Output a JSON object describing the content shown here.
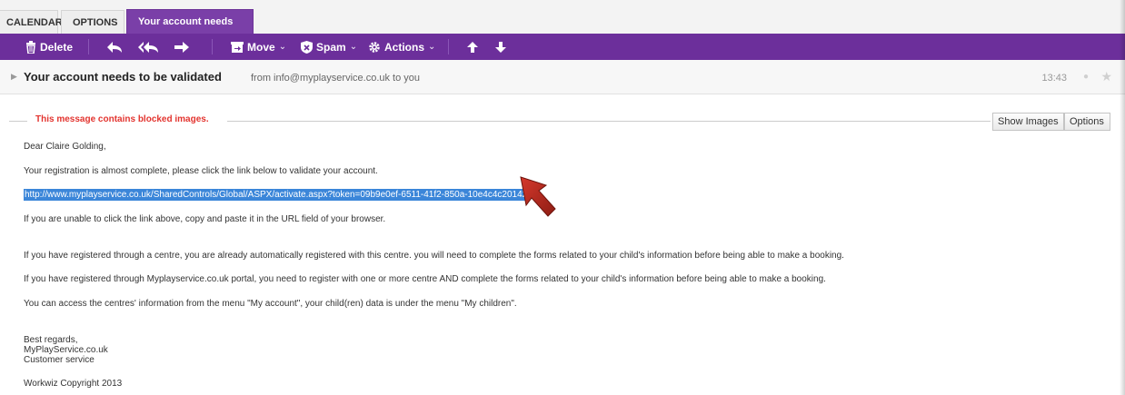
{
  "tabs": [
    {
      "label": "CALENDAR"
    },
    {
      "label": "OPTIONS"
    },
    {
      "label": "Your account needs ..."
    }
  ],
  "toolbar": {
    "delete_label": "Delete",
    "move_label": "Move",
    "spam_label": "Spam",
    "actions_label": "Actions",
    "caret": "⌄",
    "icons": [
      "trash-icon",
      "reply-icon",
      "reply-all-icon",
      "forward-icon",
      "move-icon",
      "spam-icon",
      "gear-icon",
      "up-arrow-icon",
      "down-arrow-icon"
    ]
  },
  "message": {
    "subject": "Your account needs to be validated",
    "from_line": "from info@myplayservice.co.uk to you",
    "time": "13:43",
    "blocked_notice": "This message contains blocked images.",
    "show_images_label": "Show Images",
    "options_label": "Options",
    "greeting": "Dear Claire Golding,",
    "line1": "Your registration is almost complete, please click the link below to validate your account.",
    "link": "http://www.myplayservice.co.uk/SharedControls/Global/ASPX/activate.aspx?token=09b9e0ef-6511-41f2-850a-10e4c4c20142",
    "line2": "If you are unable to click the link above, copy and paste it in the URL field of your browser.",
    "line3": "If you have registered through a centre, you are already automatically registered with this centre. you will need to complete the forms related to your child's information before being able to make a booking.",
    "line4": "If you have registered through Myplayservice.co.uk portal, you need to register with one or more centre AND complete the forms related to your child's information before being able to make a booking.",
    "line5": "You can access the centres' information from the menu  \"My account\", your child(ren) data is under the menu \"My children\".",
    "sign1": "Best regards,",
    "sign2": "MyPlayService.co.uk",
    "sign3": "Customer service",
    "copyright": "Workwiz Copyright 2013"
  },
  "colors": {
    "toolbar": "#6c2f9b",
    "active_tab": "#7a3fa8",
    "blocked_text": "#e3342f",
    "link_highlight": "#3b86d9",
    "arrow": "#b8281e"
  }
}
